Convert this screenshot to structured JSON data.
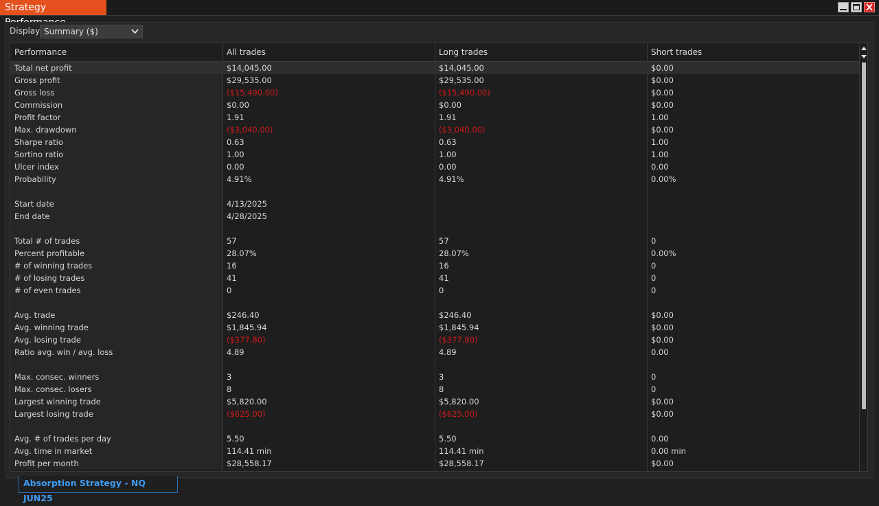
{
  "window": {
    "title": "Strategy Performance"
  },
  "display": {
    "label": "Display",
    "selected": "Summary ($)"
  },
  "grid": {
    "headers": [
      "Performance",
      "All trades",
      "Long trades",
      "Short trades"
    ],
    "rows": [
      {
        "label": "Total net profit",
        "all": "$14,045.00",
        "long": "$14,045.00",
        "short": "$0.00",
        "selected": true
      },
      {
        "label": "Gross profit",
        "all": "$29,535.00",
        "long": "$29,535.00",
        "short": "$0.00"
      },
      {
        "label": "Gross loss",
        "all": "($15,490.00)",
        "long": "($15,490.00)",
        "short": "$0.00",
        "neg": true
      },
      {
        "label": "Commission",
        "all": "$0.00",
        "long": "$0.00",
        "short": "$0.00"
      },
      {
        "label": "Profit factor",
        "all": "1.91",
        "long": "1.91",
        "short": "1.00"
      },
      {
        "label": "Max. drawdown",
        "all": "($3,040.00)",
        "long": "($3,040.00)",
        "short": "$0.00",
        "neg": true
      },
      {
        "label": "Sharpe ratio",
        "all": "0.63",
        "long": "0.63",
        "short": "1.00"
      },
      {
        "label": "Sortino ratio",
        "all": "1.00",
        "long": "1.00",
        "short": "1.00"
      },
      {
        "label": "Ulcer index",
        "all": "0.00",
        "long": "0.00",
        "short": "0.00"
      },
      {
        "label": "Probability",
        "all": "4.91%",
        "long": "4.91%",
        "short": "0.00%"
      },
      {
        "label": "",
        "all": "",
        "long": "",
        "short": ""
      },
      {
        "label": "Start date",
        "all": "4/13/2025",
        "long": "",
        "short": ""
      },
      {
        "label": "End date",
        "all": "4/28/2025",
        "long": "",
        "short": ""
      },
      {
        "label": "",
        "all": "",
        "long": "",
        "short": ""
      },
      {
        "label": "Total # of trades",
        "all": "57",
        "long": "57",
        "short": "0"
      },
      {
        "label": "Percent profitable",
        "all": "28.07%",
        "long": "28.07%",
        "short": "0.00%"
      },
      {
        "label": "# of winning trades",
        "all": "16",
        "long": "16",
        "short": "0"
      },
      {
        "label": "# of losing trades",
        "all": "41",
        "long": "41",
        "short": "0"
      },
      {
        "label": "# of even trades",
        "all": "0",
        "long": "0",
        "short": "0"
      },
      {
        "label": "",
        "all": "",
        "long": "",
        "short": ""
      },
      {
        "label": "Avg. trade",
        "all": "$246.40",
        "long": "$246.40",
        "short": "$0.00"
      },
      {
        "label": "Avg. winning trade",
        "all": "$1,845.94",
        "long": "$1,845.94",
        "short": "$0.00"
      },
      {
        "label": "Avg. losing trade",
        "all": "($377.80)",
        "long": "($377.80)",
        "short": "$0.00",
        "neg": true
      },
      {
        "label": "Ratio avg. win / avg. loss",
        "all": "4.89",
        "long": "4.89",
        "short": "0.00"
      },
      {
        "label": "",
        "all": "",
        "long": "",
        "short": ""
      },
      {
        "label": "Max. consec. winners",
        "all": "3",
        "long": "3",
        "short": "0"
      },
      {
        "label": "Max. consec. losers",
        "all": "8",
        "long": "8",
        "short": "0"
      },
      {
        "label": "Largest winning trade",
        "all": "$5,820.00",
        "long": "$5,820.00",
        "short": "$0.00"
      },
      {
        "label": "Largest losing trade",
        "all": "($625.00)",
        "long": "($625.00)",
        "short": "$0.00",
        "neg": true
      },
      {
        "label": "",
        "all": "",
        "long": "",
        "short": ""
      },
      {
        "label": "Avg. # of trades per day",
        "all": "5.50",
        "long": "5.50",
        "short": "0.00"
      },
      {
        "label": "Avg. time in market",
        "all": "114.41 min",
        "long": "114.41 min",
        "short": "0.00 min"
      },
      {
        "label": "Profit per month",
        "all": "$28,558.17",
        "long": "$28,558.17",
        "short": "$0.00"
      }
    ]
  },
  "footer": {
    "tab_label": "Absorption Strategy - NQ JUN25"
  },
  "colors": {
    "accent": "#e4511e",
    "negative": "#d0191b",
    "tab_text": "#3e9bf2"
  }
}
